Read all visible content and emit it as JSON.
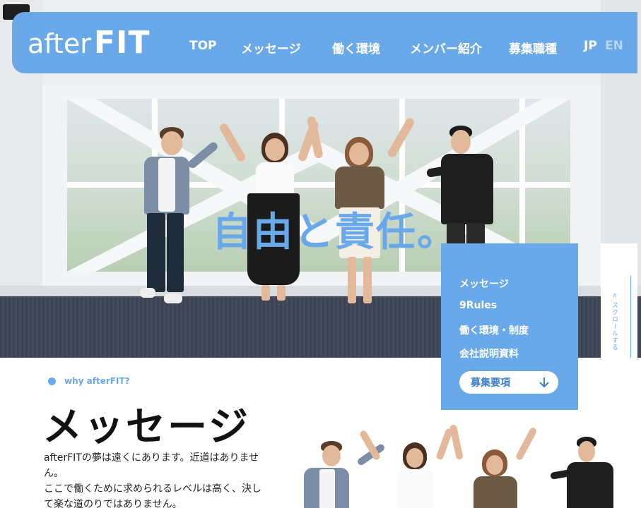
{
  "brand": {
    "logo_after": "after",
    "logo_fit": "FIT",
    "accent_color": "#6aa9e9"
  },
  "nav": {
    "items": [
      {
        "label": "TOP"
      },
      {
        "label": "メッセージ"
      },
      {
        "label": "働く環境"
      },
      {
        "label": "メンバー紹介"
      },
      {
        "label": "募集職種"
      }
    ],
    "lang_jp": "JP",
    "lang_en": "EN"
  },
  "hero": {
    "catch_copy": "自由と責任。"
  },
  "side_menu": {
    "links": [
      {
        "label": "メッセージ"
      },
      {
        "label": "9Rules"
      },
      {
        "label": "働く環境・制度"
      },
      {
        "label": "会社説明資料"
      }
    ],
    "recruit_label": "募集要項",
    "recruit_icon": "arrow-down-icon"
  },
  "scroll": {
    "label": "< スクロールする"
  },
  "message_section": {
    "eyebrow": "why afterFIT?",
    "title": "メッセージ",
    "lines": [
      "afterFITの夢は遠くにあります。近道はありませ",
      "ん。",
      "ここで働くために求められるレベルは高く、決し",
      "て楽な道のりではありません。"
    ]
  }
}
